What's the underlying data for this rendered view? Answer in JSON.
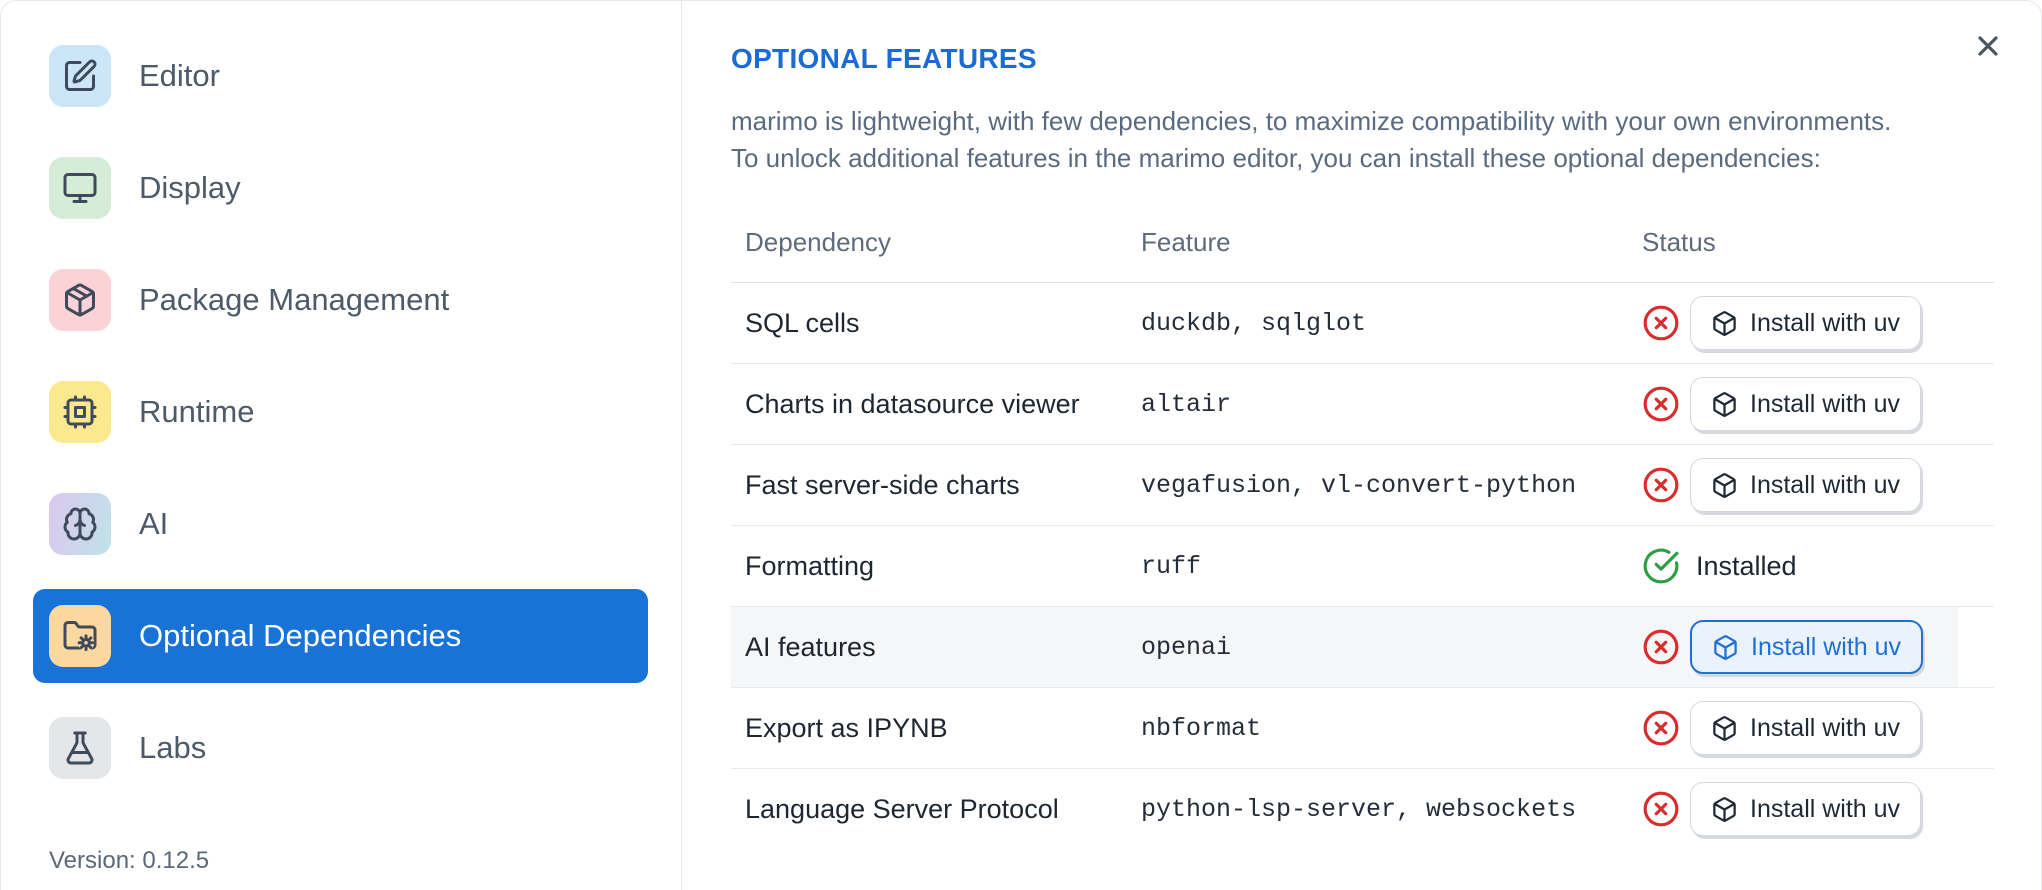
{
  "sidebar": {
    "items": [
      {
        "label": "Editor",
        "icon": "square-pen-icon",
        "tile_color": "#cde6f7",
        "selected": false
      },
      {
        "label": "Display",
        "icon": "monitor-icon",
        "tile_color": "#d5edd6",
        "selected": false
      },
      {
        "label": "Package Management",
        "icon": "package-icon",
        "tile_color": "#fbd2d5",
        "selected": false
      },
      {
        "label": "Runtime",
        "icon": "cpu-icon",
        "tile_color": "#fbe88f",
        "selected": false
      },
      {
        "label": "AI",
        "icon": "brain-icon",
        "tile_color": "gradient #dcc8ef to #bfe2e9",
        "selected": false
      },
      {
        "label": "Optional Dependencies",
        "icon": "folder-cog-icon",
        "tile_color": "#fbd8a0",
        "selected": true
      },
      {
        "label": "Labs",
        "icon": "flask-icon",
        "tile_color": "#e5e6e8",
        "selected": false
      }
    ],
    "version_label": "Version: 0.12.5"
  },
  "main": {
    "title": "OPTIONAL FEATURES",
    "description_line1": "marimo is lightweight, with few dependencies, to maximize compatibility with your own environments.",
    "description_line2": "To unlock additional features in the marimo editor, you can install these optional dependencies:",
    "close_icon": "x-icon",
    "table": {
      "columns": [
        "Dependency",
        "Feature",
        "Status"
      ],
      "rows": [
        {
          "dependency": "SQL cells",
          "feature": "duckdb, sqlglot",
          "installed": false,
          "status_icon": "circle-x-icon",
          "action": "Install with uv"
        },
        {
          "dependency": "Charts in datasource viewer",
          "feature": "altair",
          "installed": false,
          "status_icon": "circle-x-icon",
          "action": "Install with uv"
        },
        {
          "dependency": "Fast server-side charts",
          "feature": "vegafusion, vl-convert-python",
          "installed": false,
          "status_icon": "circle-x-icon",
          "action": "Install with uv"
        },
        {
          "dependency": "Formatting",
          "feature": "ruff",
          "installed": true,
          "status_icon": "circle-check-icon",
          "status_label": "Installed"
        },
        {
          "dependency": "AI features",
          "feature": "openai",
          "installed": false,
          "status_icon": "circle-x-icon",
          "action": "Install with uv",
          "highlighted": true
        },
        {
          "dependency": "Export as IPYNB",
          "feature": "nbformat",
          "installed": false,
          "status_icon": "circle-x-icon",
          "action": "Install with uv"
        },
        {
          "dependency": "Language Server Protocol",
          "feature": "python-lsp-server, websockets",
          "installed": false,
          "status_icon": "circle-x-icon",
          "action": "Install with uv"
        }
      ]
    }
  },
  "colors": {
    "accent_blue": "#1b6bd2",
    "selected_item_bg": "#1973d6",
    "error_red": "#d92c2c",
    "success_green": "#2e9e44",
    "highlighted_button_bg": "#eaf3fd",
    "highlighted_button_border": "#2170d0",
    "highlighted_row_bg": "#f5f6f8"
  }
}
